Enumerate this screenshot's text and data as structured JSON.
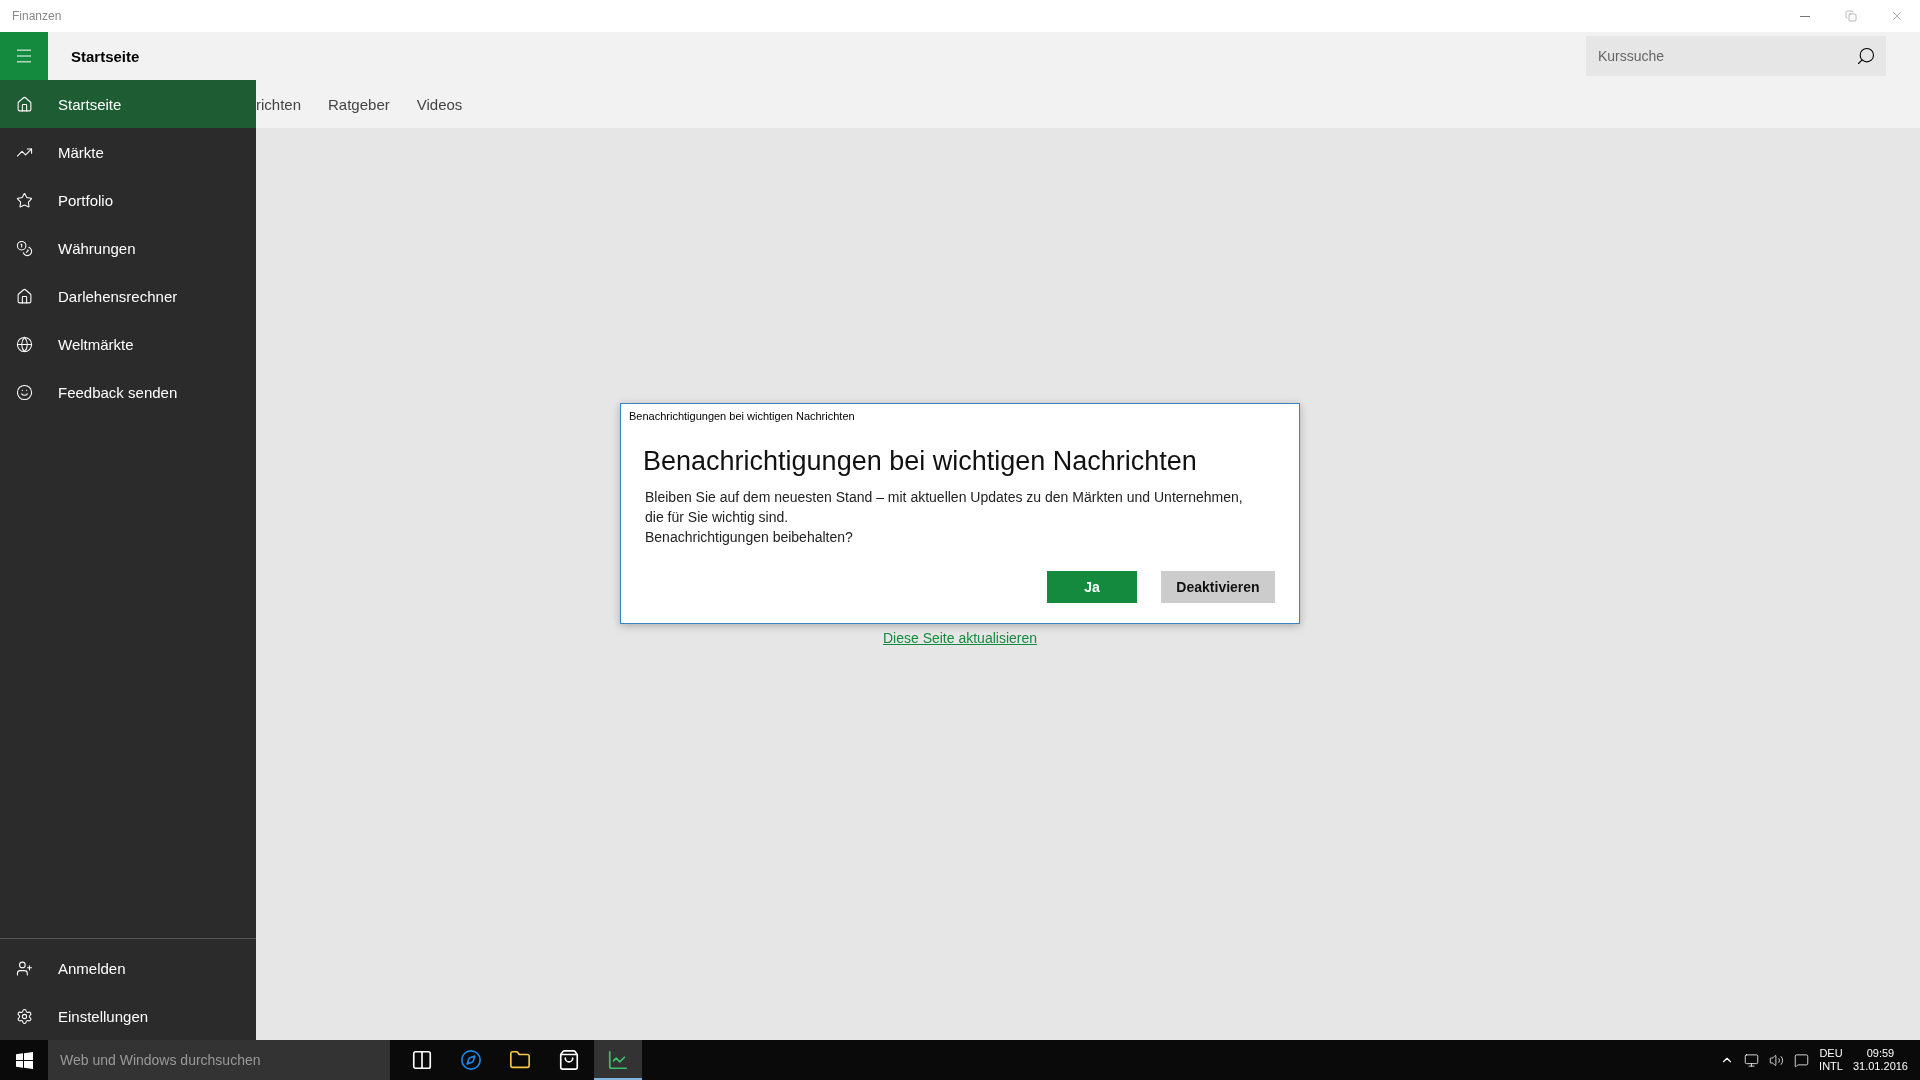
{
  "window": {
    "title": "Finanzen"
  },
  "header": {
    "page_title": "Startseite",
    "search": {
      "placeholder": "Kurssuche"
    }
  },
  "tabs": [
    {
      "label": "richten"
    },
    {
      "label": "Ratgeber"
    },
    {
      "label": "Videos"
    }
  ],
  "sidebar": {
    "items": [
      {
        "label": "Startseite",
        "kind": "home",
        "selected": true
      },
      {
        "label": "Märkte",
        "kind": "trend",
        "selected": false
      },
      {
        "label": "Portfolio",
        "kind": "star",
        "selected": false
      },
      {
        "label": "Währungen",
        "kind": "currency",
        "selected": false
      },
      {
        "label": "Darlehensrechner",
        "kind": "loan",
        "selected": false
      },
      {
        "label": "Weltmärkte",
        "kind": "globe",
        "selected": false
      },
      {
        "label": "Feedback senden",
        "kind": "smile",
        "selected": false
      }
    ],
    "bottom_items": [
      {
        "label": "Anmelden",
        "kind": "user",
        "selected": false
      },
      {
        "label": "Einstellungen",
        "kind": "settings",
        "selected": false
      }
    ]
  },
  "content": {
    "link": "Diese Seite aktualisieren"
  },
  "dialog": {
    "window_title": "Benachrichtigungen bei wichtigen Nachrichten",
    "title": "Benachrichtigungen bei wichtigen Nachrichten",
    "body": [
      "Bleiben Sie auf dem neuesten Stand – mit aktuellen Updates zu den Märkten und Unternehmen,",
      "die für Sie wichtig sind.",
      "Benachrichtigungen beibehalten?"
    ],
    "buttons": [
      {
        "label": "Ja",
        "kind": "primary"
      },
      {
        "label": "Deaktivieren",
        "kind": "secondary"
      }
    ]
  },
  "taskbar": {
    "search": {
      "placeholder": "Web und Windows durchsuchen"
    },
    "apps": [
      {
        "kind": "taskview",
        "selected": false
      },
      {
        "kind": "browser",
        "selected": false
      },
      {
        "kind": "folder",
        "selected": false
      },
      {
        "kind": "store",
        "selected": false
      },
      {
        "kind": "finance",
        "selected": true
      }
    ],
    "language": [
      "DEU",
      "INTL"
    ],
    "time": "09:59",
    "date": "31.01.2016"
  }
}
